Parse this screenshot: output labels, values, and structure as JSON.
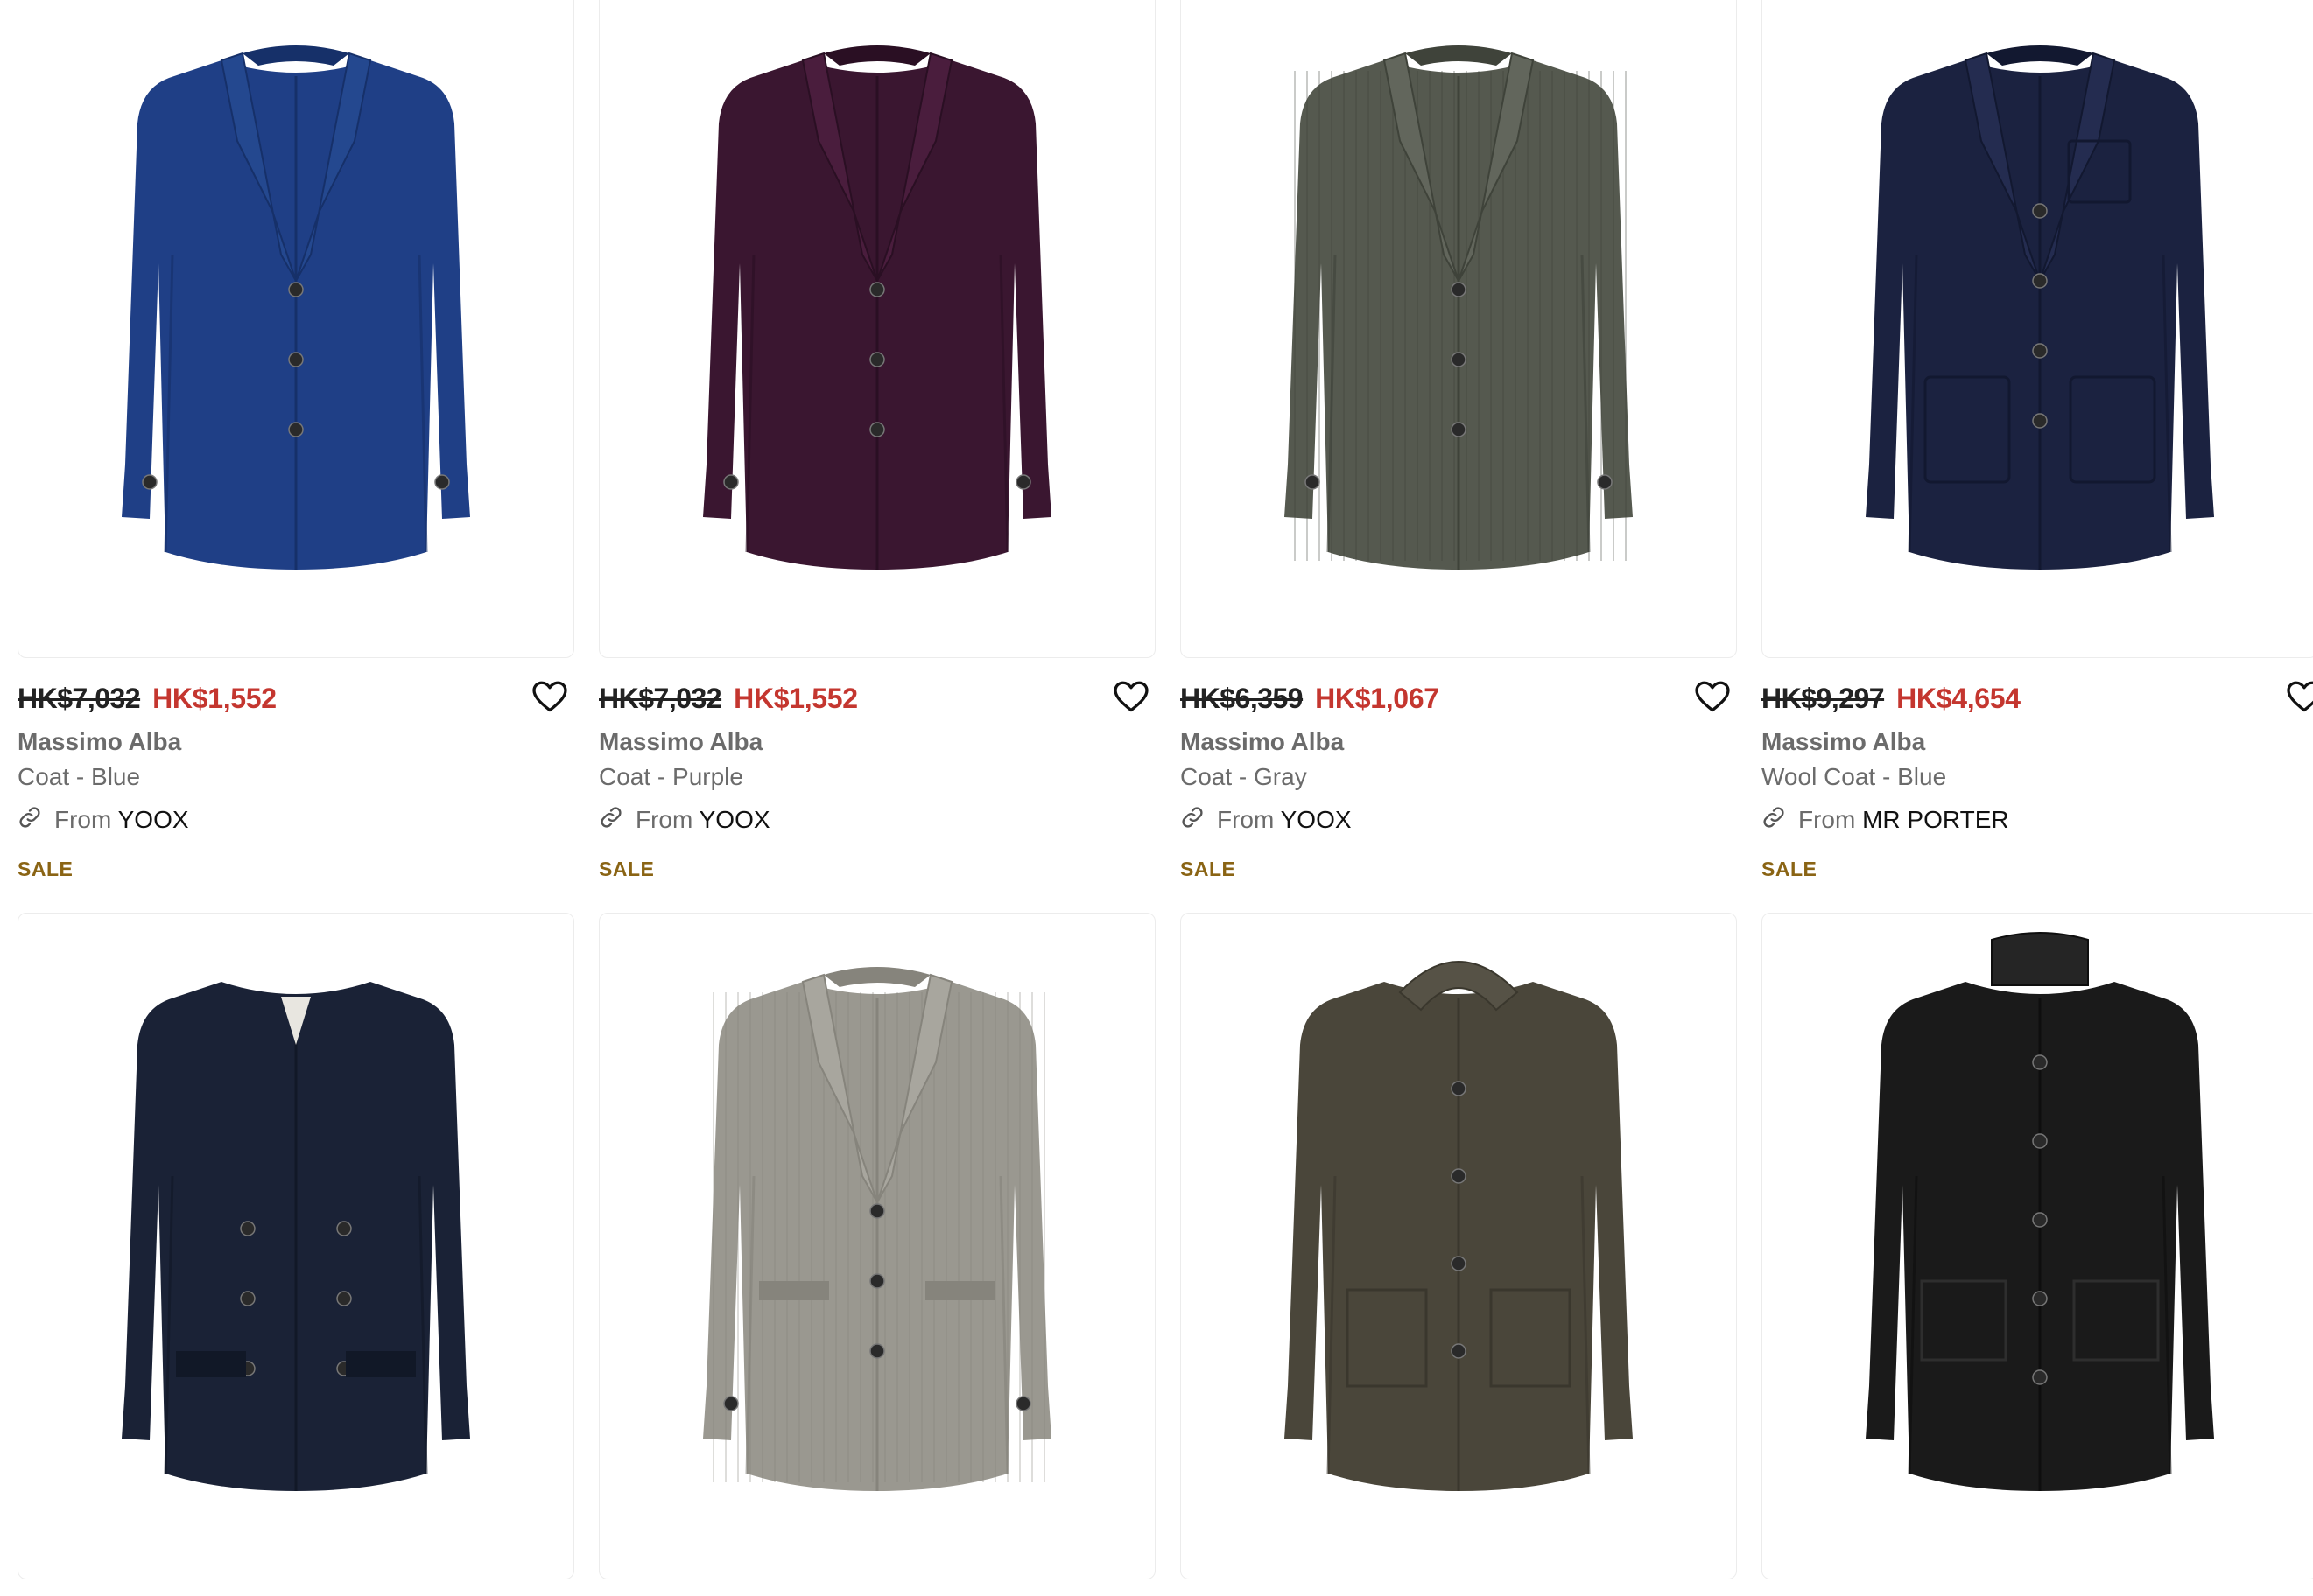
{
  "colors": {
    "sale_price": "#c4362f",
    "sale_badge": "#8a6414",
    "meta_text": "#6b6b6b",
    "card_border": "#ececec"
  },
  "products": [
    {
      "old_price": "HK$7,032",
      "sale_price": "HK$1,552",
      "brand": "Massimo Alba",
      "name": "Coat - Blue",
      "source_prefix": "From",
      "store": "YOOX",
      "badge": "SALE",
      "icon": "heart-outline-icon",
      "image": {
        "style": "single-breasted",
        "color": "#1f3f86",
        "shade": "#163069",
        "collar": "#24488f"
      }
    },
    {
      "old_price": "HK$7,032",
      "sale_price": "HK$1,552",
      "brand": "Massimo Alba",
      "name": "Coat - Purple",
      "source_prefix": "From",
      "store": "YOOX",
      "badge": "SALE",
      "icon": "heart-outline-icon",
      "image": {
        "style": "single-breasted",
        "color": "#3a1630",
        "shade": "#2a0f23",
        "collar": "#4a1d3d"
      }
    },
    {
      "old_price": "HK$6,359",
      "sale_price": "HK$1,067",
      "brand": "Massimo Alba",
      "name": "Coat - Gray",
      "source_prefix": "From",
      "store": "YOOX",
      "badge": "SALE",
      "icon": "heart-outline-icon",
      "image": {
        "style": "houndstooth",
        "color": "#55594f",
        "shade": "#3f433a",
        "collar": "#62665c"
      }
    },
    {
      "old_price": "HK$9,297",
      "sale_price": "HK$4,654",
      "brand": "Massimo Alba",
      "name": "Wool Coat - Blue",
      "source_prefix": "From",
      "store": "MR PORTER",
      "badge": "SALE",
      "icon": "heart-outline-icon",
      "image": {
        "style": "patch-pockets",
        "color": "#1b2240",
        "shade": "#121830",
        "collar": "#242c50"
      }
    },
    {
      "image": {
        "style": "double-breasted",
        "color": "#1a2236",
        "shade": "#111827",
        "collar": "#222b42"
      }
    },
    {
      "image": {
        "style": "herringbone",
        "color": "#9a9890",
        "shade": "#86847c",
        "collar": "#a8a69e"
      }
    },
    {
      "image": {
        "style": "hooded",
        "color": "#4a463a",
        "shade": "#3a372d",
        "collar": "#565246"
      }
    },
    {
      "image": {
        "style": "parka",
        "color": "#1a1a1a",
        "shade": "#0e0e0e",
        "collar": "#252525"
      }
    }
  ]
}
